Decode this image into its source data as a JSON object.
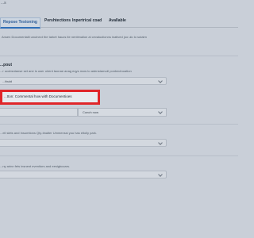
{
  "header": {
    "title": "...s"
  },
  "tabs": [
    {
      "label": "Repose Testoning",
      "active": true
    },
    {
      "label": "Pershtections",
      "active": false
    },
    {
      "label": "Inpertrical coad",
      "active": false
    },
    {
      "label": "Avallable",
      "active": false
    }
  ],
  "intro_text": "Ansen Documentalii unulnect the tarket hauzs ite nentimalion al cevaluolionns inatived joo ulo lo sutaim",
  "section1": {
    "title": "...pout",
    "description": "...r ucobsntanse set ane is user oirent taonae anag eqys mow to adenstanvoll ponbectnoation",
    "select_value": "...tbuld"
  },
  "highlighted_item": {
    "label": "...tton: Commental how with Documentioes",
    "highlight_color": "#e0262a"
  },
  "inputs": {
    "left_value": "",
    "right_value": "Conch now"
  },
  "section2": {
    "description": "...ell slets and Insumtions Qty-tinalter Ummenssi you has eltolly park."
  },
  "section3": {
    "description": "...ny arinn fets insnent evenitors and eesigbcoars."
  }
}
